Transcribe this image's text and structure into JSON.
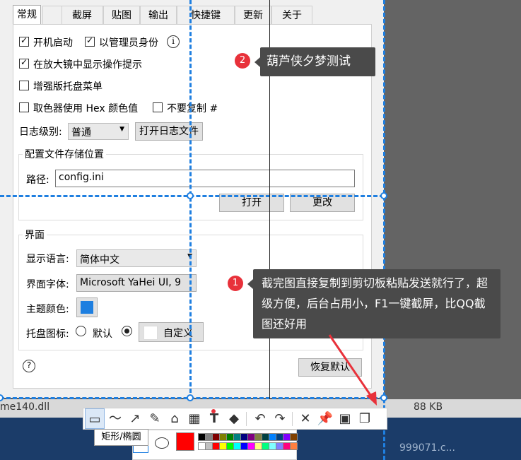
{
  "tabs": [
    "常规",
    "截屏",
    "贴图",
    "输出",
    "快捷键",
    "更新",
    "关于"
  ],
  "general": {
    "autostart": "开机启动",
    "run_as_admin": "以管理员身份",
    "show_magnifier_tips": "在放大镜中显示操作提示",
    "enhanced_tray_menu": "增强版托盘菜单",
    "picker_hex": "取色器使用 Hex 颜色值",
    "no_copy_hash": "不要复制 #",
    "log_level_label": "日志级别:",
    "log_level_value": "普通",
    "open_log_button": "打开日志文件",
    "config_group_title": "配置文件存储位置",
    "path_label": "路径:",
    "path_value": "config.ini",
    "open_button": "打开",
    "change_button": "更改",
    "ui_group_title": "界面",
    "display_lang_label": "显示语言:",
    "display_lang_value": "简体中文",
    "ui_font_label": "界面字体:",
    "ui_font_value": "Microsoft YaHei UI, 9",
    "theme_color_label": "主题颜色:",
    "theme_color": "#1e7fe0",
    "tray_icon_label": "托盘图标:",
    "tray_default": "默认",
    "tray_custom": "自定义",
    "restore_defaults_button": "恢复默认",
    "help_icon": "?",
    "info_icon": "i"
  },
  "annotations": {
    "badge1": "1",
    "callout1": "截完图直接复制到剪切板粘贴发送就行了，超级方便，后台占用小，F1一键截屏，比QQ截图还好用",
    "badge2": "2",
    "callout2": "葫芦侠夕梦测试"
  },
  "background": {
    "file_fragment": "me140.dll",
    "size_fragment": "88 KB",
    "file_fragment2": "999071.c..."
  },
  "toolbar": {
    "tooltip": "矩形/椭圆",
    "tools": [
      "rectangle-ellipse-icon",
      "curve-icon",
      "arrow-icon",
      "pen-icon",
      "marker-icon",
      "mosaic-icon",
      "text-icon",
      "eraser-icon",
      "undo-icon",
      "redo-icon",
      "cancel-icon",
      "pin-icon",
      "save-icon",
      "copy-icon"
    ]
  },
  "palette": {
    "current": "#ff0000",
    "colors_row1": [
      "#000000",
      "#808080",
      "#800000",
      "#808000",
      "#008000",
      "#008080",
      "#000080",
      "#800080",
      "#808040",
      "#004040",
      "#0080ff",
      "#004080",
      "#8000ff",
      "#804000"
    ],
    "colors_row2": [
      "#ffffff",
      "#c0c0c0",
      "#ff0000",
      "#ffff00",
      "#00ff00",
      "#00ffff",
      "#0000ff",
      "#ff00ff",
      "#ffff80",
      "#00ff80",
      "#80ffff",
      "#8080ff",
      "#ff0080",
      "#ff8040"
    ]
  }
}
